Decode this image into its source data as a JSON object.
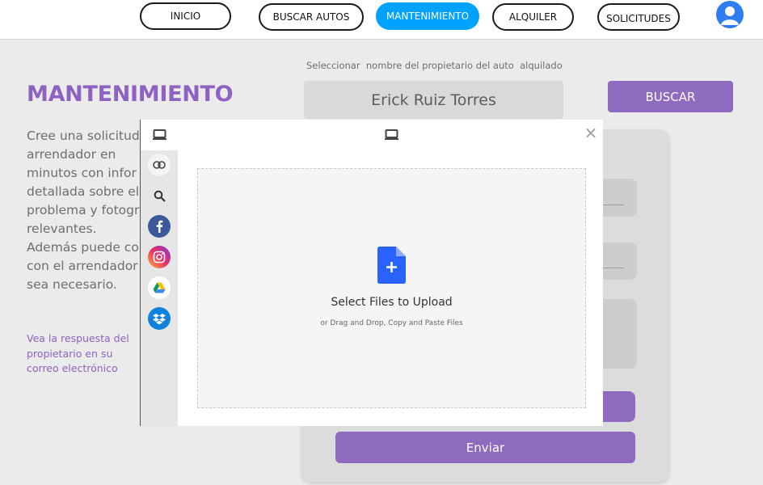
{
  "nav": {
    "items": [
      {
        "label": "INICIO",
        "active": false
      },
      {
        "label": "BUSCAR AUTOS",
        "active": false
      },
      {
        "label": "MANTENIMIENTO",
        "active": true
      },
      {
        "label": "ALQUILER",
        "active": false
      },
      {
        "label": "SOLICITUDES",
        "active": false
      }
    ]
  },
  "page": {
    "title": "MANTENIMIENTO",
    "intro": "Cree una solicitud\n arrendador en\nminutos con infor\ndetallada sobre el\nproblema y fotogr\nrelevantes.\nAdemás puede co\ncon el arrendador\nsea necesario.",
    "note": "Vea la respuesta del propietario en su correo electrónico"
  },
  "search": {
    "label": "Seleccionar  nombre del propietario del auto  alquilado",
    "value": "Erick Ruiz Torres",
    "button_label": "BUSCAR"
  },
  "form": {
    "send_label": "Enviar"
  },
  "upload": {
    "close_glyph": "×",
    "title": "Select Files to Upload",
    "subtitle": "or Drag and Drop, Copy and Paste Files",
    "sources": [
      "computer",
      "link",
      "web-search",
      "facebook",
      "instagram",
      "google-drive",
      "dropbox"
    ]
  },
  "colors": {
    "accent_purple": "#8e6bbf",
    "nav_active": "#00a2ff",
    "upload_icon": "#2962ff"
  }
}
